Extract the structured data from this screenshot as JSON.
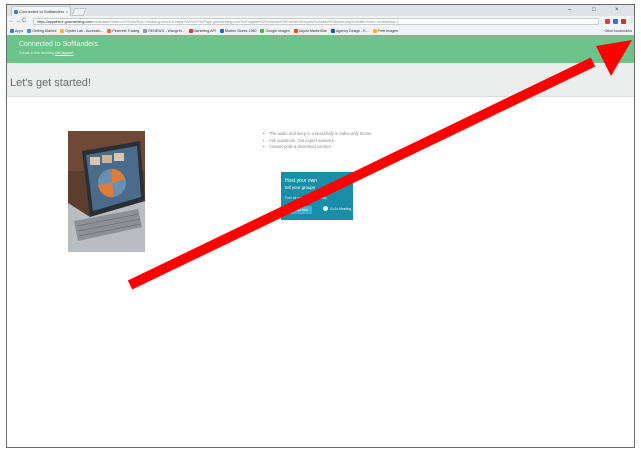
{
  "browser": {
    "tab_title": "Connected to Softlanders",
    "tab_close": "×",
    "window_controls": [
      "–",
      "□",
      "×"
    ],
    "nav": {
      "back": "←",
      "forward": "→",
      "reload": "C",
      "home": "⌂"
    },
    "url_host": "https://appwhere.gotomeeting.com",
    "url_rest": "/hosts/start?token=GX9v5w9fQo1h&dialog=true&ui=https%3A%2F%2Fapp.gotomeeting.com%2Fregister%2Fwelcome%3FrefId%3Dtopbar%26siteId%3Dweb-eng%26offer=learn-more#hosts-1",
    "bookmarks": [
      "Apps",
      "Getting Started",
      "Oyster Lab - Accessib...",
      "Pinterest Tracing",
      "RENEWG - Wangzhi...",
      "Marketing API",
      "Marker Stores 1980",
      "Google Images",
      "Adjust MarketSite",
      "Agency Design - K...",
      "Free Images"
    ],
    "bookmarks_right": "Other bookmarks"
  },
  "page": {
    "brand": "Connected to Softlanders",
    "tagline_text": "Create a free meeting",
    "tagline_link": "Get support",
    "hero_title": "Let's get started!",
    "bullets": [
      "The audio and keep in a beautifully in index-only theme.",
      "Ask questions. Get expert answers.",
      "Answer polls & download content."
    ],
    "ad": {
      "line1": "Host your own",
      "line2": "tell your groups",
      "subtitle": "Free all you do easy & easy",
      "button": "Start for free",
      "logo": "GoTo Meeting"
    }
  },
  "colors": {
    "header_green": "#6cc48a",
    "hero_gray": "#eceeee",
    "ad_teal": "#1a8ea6",
    "annotation_red": "#ff0000"
  }
}
